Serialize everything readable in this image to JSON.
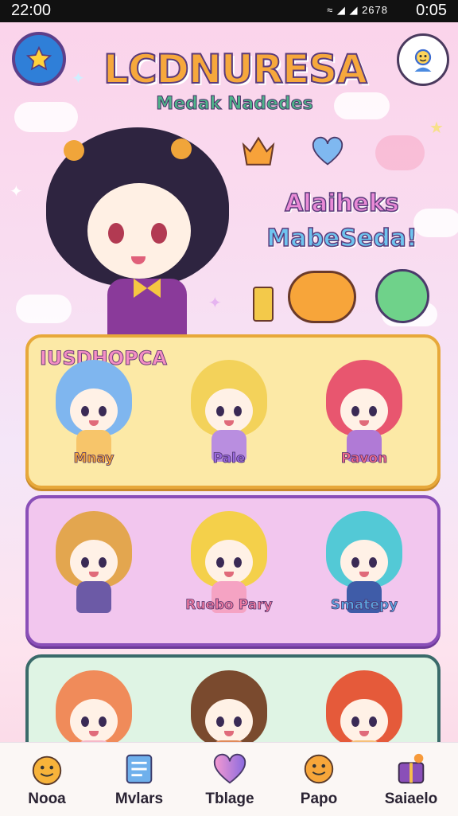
{
  "status": {
    "time_left": "22:00",
    "time_right": "0:05",
    "indicator": "≈ ◢ ◢ 2678"
  },
  "header": {
    "title": "LCDNURESA",
    "subtitle": "Medak Nadedes"
  },
  "promo": {
    "line1": "Alaiheks",
    "line2": "MabeSeda!"
  },
  "panels": [
    {
      "heading": "IUSDHOPCA",
      "characters": [
        {
          "name": "Mnay",
          "hair": "#7fb6ef",
          "body": "#f7c56a"
        },
        {
          "name": "Pale",
          "hair": "#f3d25a",
          "body": "#b98ee0"
        },
        {
          "name": "Pavon",
          "hair": "#e8566f",
          "body": "#b07ad6"
        }
      ]
    },
    {
      "heading": "",
      "characters": [
        {
          "name": "",
          "hair": "#e3a64f",
          "body": "#6c5aa6"
        },
        {
          "name": "Ruebo Pary",
          "hair": "#f4d04a",
          "body": "#f5a3c3"
        },
        {
          "name": "Smatepy",
          "hair": "#53c9d6",
          "body": "#3f5ca8"
        }
      ]
    },
    {
      "heading": "",
      "characters": [
        {
          "name": "",
          "hair": "#f08b5a",
          "body": "#f6b8c8"
        },
        {
          "name": "",
          "hair": "#7a4a2e",
          "body": "#e08a5a"
        },
        {
          "name": "",
          "hair": "#e55a3a",
          "body": "#f6c07a"
        }
      ]
    }
  ],
  "nav": [
    {
      "label": "Nooa",
      "icon": "happy-face-icon"
    },
    {
      "label": "Mvlars",
      "icon": "book-icon"
    },
    {
      "label": "Tblage",
      "icon": "heart-icon"
    },
    {
      "label": "Papo",
      "icon": "smile-icon"
    },
    {
      "label": "Saiaelo",
      "icon": "gift-box-icon"
    }
  ],
  "colors": {
    "accent": "#8a4fb8",
    "panel1": "#fce9a6",
    "panel2": "#f2c6ee",
    "panel3": "#dff4e4"
  }
}
